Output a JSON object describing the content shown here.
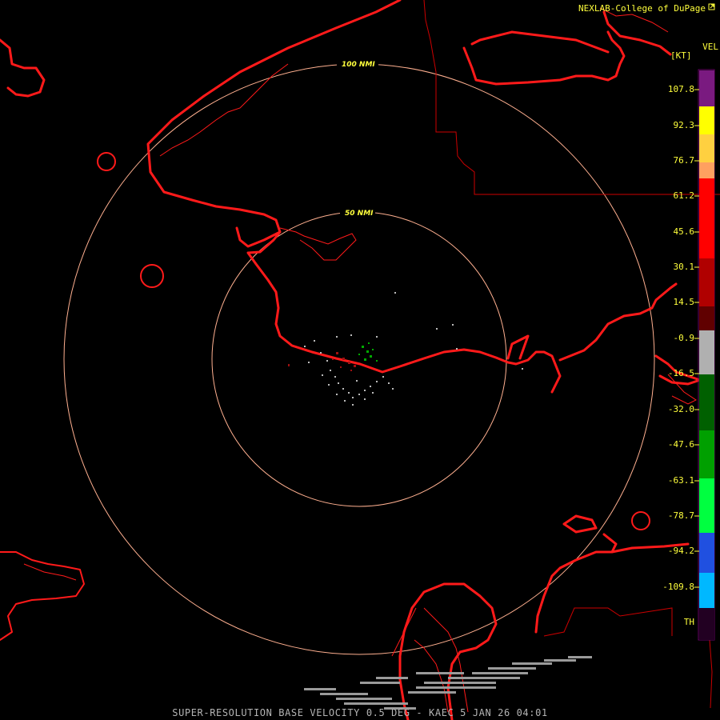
{
  "header": {
    "credit": "NEXLAB-College of DuPage",
    "product": "VEL",
    "unit": "[KT]"
  },
  "footer": "SUPER-RESOLUTION BASE VELOCITY 0.5 DEG - KAEC 5 JAN 26 04:01",
  "rings": [
    "50 NMI",
    "100 NMI"
  ],
  "legend": {
    "labels": [
      "107.8",
      "92.3",
      "76.7",
      "61.2",
      "45.6",
      "30.1",
      "14.5",
      "-0.9",
      "-16.5",
      "-32.0",
      "-47.6",
      "-63.1",
      "-78.7",
      "-94.2",
      "-109.8",
      "TH"
    ],
    "colors": {
      "purple": "#7a1a80",
      "yellow": "#ffff00",
      "orange": "#ffb070",
      "red": "#ff0000",
      "darkred": "#600000",
      "gray": "#aaaaaa",
      "green": "#00aa00",
      "brightgreen": "#00ff40",
      "blue": "#2050e0",
      "cyan": "#00b8ff",
      "th": "#220022"
    }
  },
  "colors": {
    "coastline": "#ff1a1a",
    "border": "#cc0000",
    "ring": "#ffb090",
    "label": "#ffff3c"
  },
  "icons": [
    "external-link-icon"
  ]
}
